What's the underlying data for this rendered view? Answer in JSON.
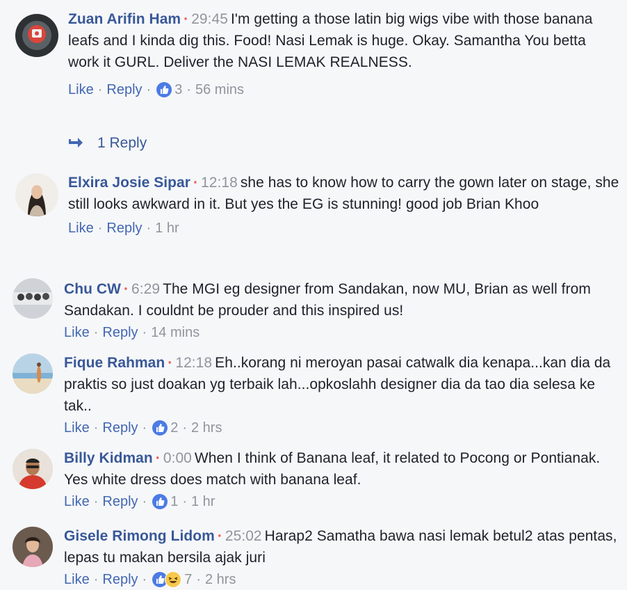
{
  "comments": [
    {
      "name": "Zuan Arifin Ham",
      "timestamp": "29:45",
      "text": "I'm getting a those latin big wigs vibe with those banana leafs and I kinda dig this. Food! Nasi Lemak is huge. Okay. Samantha You betta work it GURL. Deliver the NASI LEMAK REALNESS.",
      "like": "Like",
      "reply": "Reply",
      "reactions": "3",
      "time": "56 mins",
      "replies_link": "1 Reply"
    },
    {
      "name": "Elxira Josie Sipar",
      "timestamp": "12:18",
      "text": "she has to know how to carry the gown later on stage, she still looks awkward in it. But yes the EG is stunning! good job Brian Khoo",
      "like": "Like",
      "reply": "Reply",
      "time": "1 hr"
    },
    {
      "name": "Chu CW",
      "timestamp": "6:29",
      "text": "The MGI eg designer from Sandakan, now MU, Brian as well from Sandakan. I couldnt be prouder and this inspired us!",
      "like": "Like",
      "reply": "Reply",
      "time": "14 mins"
    },
    {
      "name": "Fique Rahman",
      "timestamp": "12:18",
      "text": "Eh..korang ni meroyan pasai catwalk dia kenapa...kan dia da praktis so just doakan yg terbaik lah...opkoslahh designer dia da tao dia selesa ke tak..",
      "like": "Like",
      "reply": "Reply",
      "reactions": "2",
      "time": "2 hrs"
    },
    {
      "name": "Billy Kidman",
      "timestamp": "0:00",
      "text": "When I think of Banana leaf, it related to Pocong or Pontianak. Yes white dress does match with banana leaf.",
      "like": "Like",
      "reply": "Reply",
      "reactions": "1",
      "time": "1 hr"
    },
    {
      "name": "Gisele Rimong Lidom",
      "timestamp": "25:02",
      "text": "Harap2 Samatha bawa nasi lemak betul2 atas pentas, lepas tu makan bersila ajak juri",
      "like": "Like",
      "reply": "Reply",
      "reactions": "7",
      "time": "2 hrs"
    }
  ],
  "separator": "·",
  "colors": {
    "name": "#385898",
    "link": "#4267b2",
    "meta": "#90949c",
    "timestamp_dot": "#f2534f",
    "like_reaction": "#4b7be5",
    "haha_reaction": "#f7c84b",
    "background": "#f6f7f9"
  },
  "icons": {
    "like_reaction": "thumbs-up-icon",
    "haha_reaction": "haha-emoji-icon",
    "reply_arrow": "reply-arrow-icon"
  }
}
